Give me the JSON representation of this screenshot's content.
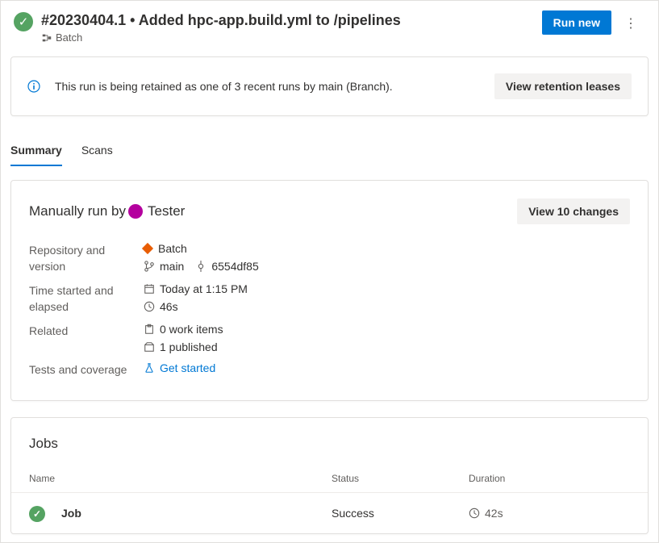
{
  "header": {
    "title": "#20230404.1 • Added hpc-app.build.yml to /pipelines",
    "subtitle": "Batch",
    "run_new_label": "Run new"
  },
  "retention": {
    "message": "This run is being retained as one of 3 recent runs by main (Branch).",
    "button_label": "View retention leases"
  },
  "tabs": {
    "summary": "Summary",
    "scans": "Scans"
  },
  "run_info": {
    "prefix": "Manually run by",
    "user": "Tester",
    "changes_label": "View 10 changes",
    "rows": {
      "repo_label": "Repository and version",
      "repo_name": "Batch",
      "branch": "main",
      "commit": "6554df85",
      "time_label": "Time started and elapsed",
      "started": "Today at 1:15 PM",
      "elapsed": "46s",
      "related_label": "Related",
      "work_items": "0 work items",
      "published": "1 published",
      "tests_label": "Tests and coverage",
      "get_started": "Get started"
    }
  },
  "jobs": {
    "heading": "Jobs",
    "columns": {
      "name": "Name",
      "status": "Status",
      "duration": "Duration"
    },
    "items": [
      {
        "name": "Job",
        "status": "Success",
        "duration": "42s"
      }
    ]
  }
}
